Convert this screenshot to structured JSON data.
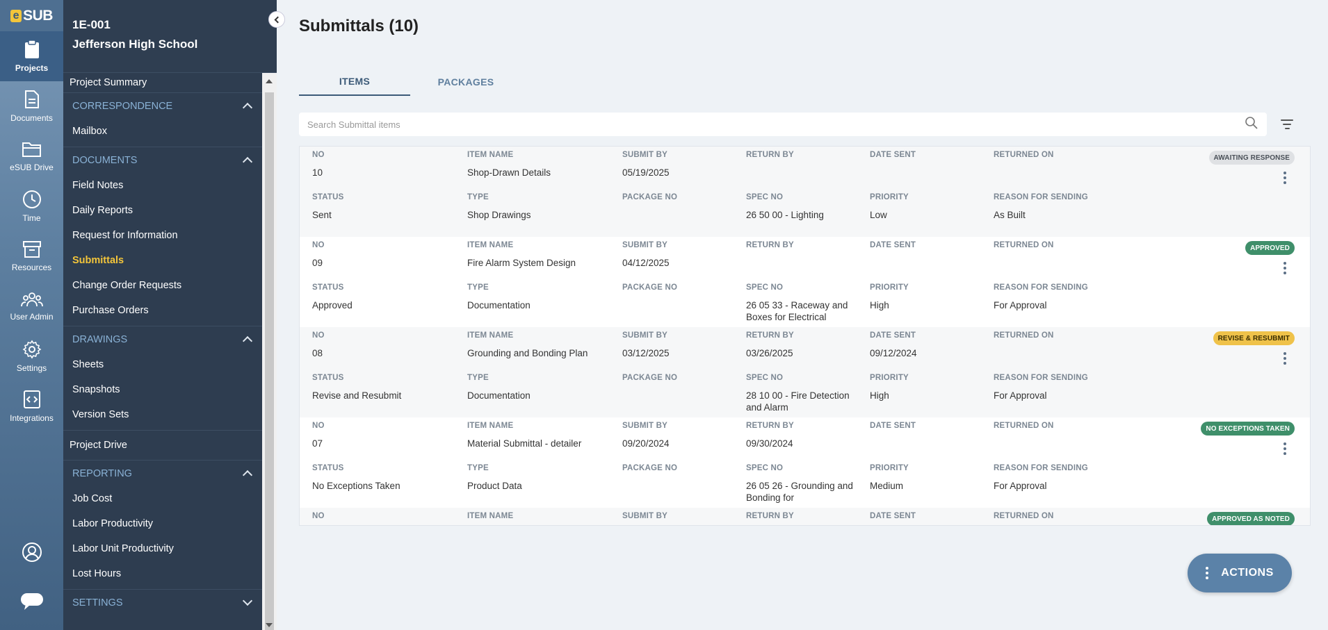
{
  "brand": {
    "logo_e": "e",
    "logo_text": "SUB"
  },
  "rail": {
    "items": [
      {
        "label": "Projects",
        "icon": "clipboard-icon",
        "active": true
      },
      {
        "label": "Documents",
        "icon": "document-icon"
      },
      {
        "label": "eSUB Drive",
        "icon": "folder-icon"
      },
      {
        "label": "Time",
        "icon": "clock-icon"
      },
      {
        "label": "Resources",
        "icon": "archive-box-icon"
      },
      {
        "label": "User Admin",
        "icon": "users-icon"
      },
      {
        "label": "Settings",
        "icon": "gear-icon"
      },
      {
        "label": "Integrations",
        "icon": "code-icon"
      }
    ]
  },
  "project": {
    "id": "1E-001",
    "name": "Jefferson High School"
  },
  "nav": {
    "project_summary": "Project Summary",
    "correspondence": {
      "title": "CORRESPONDENCE",
      "items": [
        "Mailbox"
      ]
    },
    "documents": {
      "title": "DOCUMENTS",
      "items": [
        "Field Notes",
        "Daily Reports",
        "Request for Information",
        "Submittals",
        "Change Order Requests",
        "Purchase Orders"
      ],
      "active": "Submittals"
    },
    "drawings": {
      "title": "DRAWINGS",
      "items": [
        "Sheets",
        "Snapshots",
        "Version Sets"
      ]
    },
    "project_drive": "Project Drive",
    "reporting": {
      "title": "REPORTING",
      "items": [
        "Job Cost",
        "Labor Productivity",
        "Labor Unit Productivity",
        "Lost Hours"
      ]
    },
    "settings": {
      "title": "SETTINGS"
    }
  },
  "main": {
    "title": "Submittals (10)",
    "tabs": [
      {
        "label": "ITEMS",
        "active": true
      },
      {
        "label": "PACKAGES"
      }
    ],
    "search_placeholder": "Search Submittal items",
    "actions_label": "ACTIONS"
  },
  "columns": {
    "no": "NO",
    "item_name": "ITEM NAME",
    "submit_by": "SUBMIT BY",
    "return_by": "RETURN BY",
    "date_sent": "DATE SENT",
    "returned_on": "RETURNED ON",
    "status": "STATUS",
    "type": "TYPE",
    "package_no": "PACKAGE NO",
    "spec_no": "SPEC NO",
    "priority": "PRIORITY",
    "reason": "REASON FOR SENDING"
  },
  "status_colors": {
    "awaiting": {
      "bg": "#dfe1e4",
      "fg": "#4a5058"
    },
    "approved": {
      "bg": "#3f8f6a",
      "fg": "#ffffff"
    },
    "revise": {
      "bg": "#efc24a",
      "fg": "#3a2e00"
    },
    "noexc": {
      "bg": "#3f8f6a",
      "fg": "#ffffff"
    },
    "noted": {
      "bg": "#3f8f6a",
      "fg": "#ffffff"
    }
  },
  "submittals": [
    {
      "no": "10",
      "item_name": "Shop-Drawn Details",
      "submit_by": "05/19/2025",
      "return_by": "",
      "date_sent": "",
      "returned_on": "",
      "status": "Sent",
      "type": "Shop Drawings",
      "package_no": "",
      "spec_no": "26 50 00 - Lighting",
      "priority": "Low",
      "reason": "As Built",
      "badge": "AWAITING RESPONSE",
      "badge_kind": "awaiting"
    },
    {
      "no": "09",
      "item_name": "Fire Alarm System Design",
      "submit_by": "04/12/2025",
      "return_by": "",
      "date_sent": "",
      "returned_on": "",
      "status": "Approved",
      "type": "Documentation",
      "package_no": "",
      "spec_no": "26 05 33 - Raceway and Boxes for Electrical",
      "priority": "High",
      "reason": "For Approval",
      "badge": "APPROVED",
      "badge_kind": "approved"
    },
    {
      "no": "08",
      "item_name": "Grounding and Bonding Plan",
      "submit_by": "03/12/2025",
      "return_by": "03/26/2025",
      "date_sent": "09/12/2024",
      "returned_on": "",
      "status": "Revise and Resubmit",
      "type": "Documentation",
      "package_no": "",
      "spec_no": "28 10 00 - Fire Detection and Alarm",
      "priority": "High",
      "reason": "For Approval",
      "badge": "REVISE & RESUBMIT",
      "badge_kind": "revise"
    },
    {
      "no": "07",
      "item_name": "Material Submittal - detailer",
      "submit_by": "09/20/2024",
      "return_by": "09/30/2024",
      "date_sent": "",
      "returned_on": "",
      "status": "No Exceptions Taken",
      "type": "Product Data",
      "package_no": "",
      "spec_no": "26 05 26 - Grounding and Bonding for",
      "priority": "Medium",
      "reason": "For Approval",
      "badge": "NO EXCEPTIONS TAKEN",
      "badge_kind": "noexc"
    },
    {
      "no": "",
      "item_name": "",
      "submit_by": "",
      "return_by": "",
      "date_sent": "",
      "returned_on": "",
      "status": "",
      "type": "",
      "package_no": "",
      "spec_no": "",
      "priority": "",
      "reason": "",
      "badge": "APPROVED AS NOTED",
      "badge_kind": "noted"
    }
  ]
}
